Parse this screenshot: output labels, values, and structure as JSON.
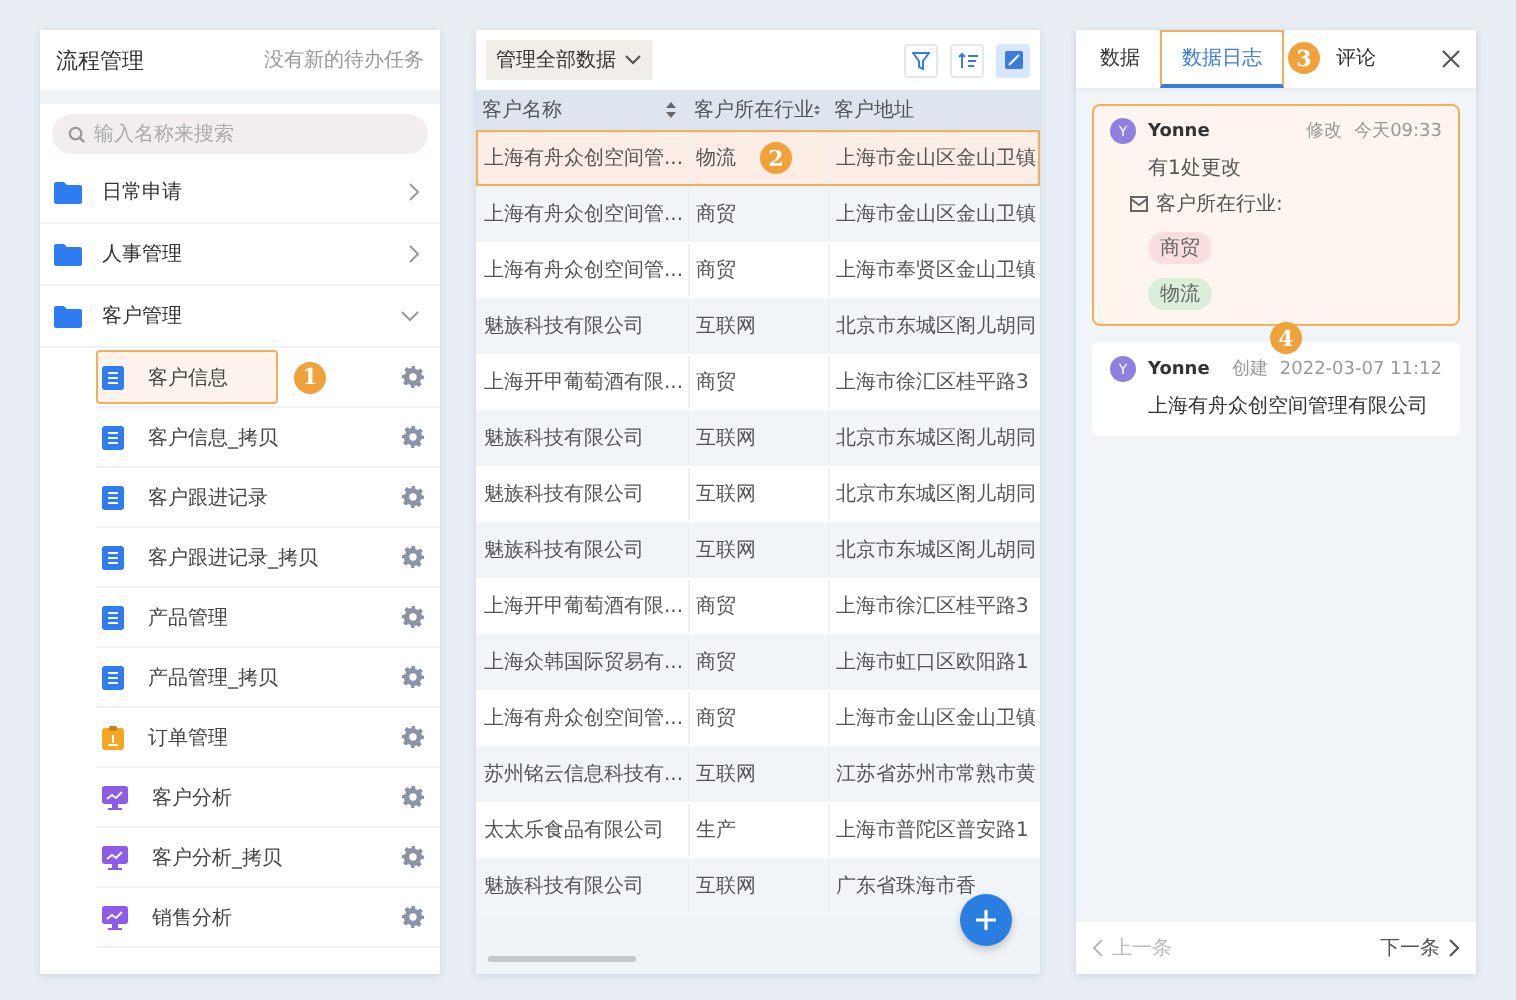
{
  "sidebar": {
    "title": "流程管理",
    "status": "没有新的待办任务",
    "search": {
      "placeholder": "输入名称来搜索"
    },
    "folders": [
      {
        "label": "日常申请",
        "expanded": false
      },
      {
        "label": "人事管理",
        "expanded": false
      },
      {
        "label": "客户管理",
        "expanded": true,
        "children": [
          {
            "label": "客户信息",
            "kind": "doc",
            "selected": true,
            "badge": "1"
          },
          {
            "label": "客户信息_拷贝",
            "kind": "doc",
            "selected": false
          },
          {
            "label": "客户跟进记录",
            "kind": "doc",
            "selected": false
          },
          {
            "label": "客户跟进记录_拷贝",
            "kind": "doc",
            "selected": false
          },
          {
            "label": "产品管理",
            "kind": "doc",
            "selected": false
          },
          {
            "label": "产品管理_拷贝",
            "kind": "doc",
            "selected": false
          },
          {
            "label": "订单管理",
            "kind": "order",
            "selected": false
          },
          {
            "label": "客户分析",
            "kind": "chart",
            "selected": false
          },
          {
            "label": "客户分析_拷贝",
            "kind": "chart",
            "selected": false
          },
          {
            "label": "销售分析",
            "kind": "chart",
            "selected": false
          }
        ]
      }
    ]
  },
  "table": {
    "scope": "管理全部数据",
    "tools": [
      {
        "kind": "filter",
        "selected": false
      },
      {
        "kind": "sort",
        "selected": false
      },
      {
        "kind": "view",
        "selected": true
      }
    ],
    "columns": [
      {
        "label": "客户名称",
        "sortable": true
      },
      {
        "label": "客户所在行业",
        "sortable": true
      },
      {
        "label": "客户地址",
        "sortable": false
      }
    ],
    "rows": [
      {
        "cells": [
          "上海有舟众创空间管...",
          "物流",
          "上海市金山区金山卫镇"
        ],
        "selected": true,
        "badge": "2"
      },
      {
        "cells": [
          "上海有舟众创空间管...",
          "商贸",
          "上海市金山区金山卫镇"
        ],
        "selected": false
      },
      {
        "cells": [
          "上海有舟众创空间管...",
          "商贸",
          "上海市奉贤区金山卫镇"
        ],
        "selected": false
      },
      {
        "cells": [
          "魅族科技有限公司",
          "互联网",
          "北京市东城区阁儿胡同"
        ],
        "selected": false
      },
      {
        "cells": [
          "上海开甲葡萄酒有限...",
          "商贸",
          "上海市徐汇区桂平路3"
        ],
        "selected": false
      },
      {
        "cells": [
          "魅族科技有限公司",
          "互联网",
          "北京市东城区阁儿胡同"
        ],
        "selected": false
      },
      {
        "cells": [
          "魅族科技有限公司",
          "互联网",
          "北京市东城区阁儿胡同"
        ],
        "selected": false
      },
      {
        "cells": [
          "魅族科技有限公司",
          "互联网",
          "北京市东城区阁儿胡同"
        ],
        "selected": false
      },
      {
        "cells": [
          "上海开甲葡萄酒有限...",
          "商贸",
          "上海市徐汇区桂平路3"
        ],
        "selected": false
      },
      {
        "cells": [
          "上海众韩国际贸易有...",
          "商贸",
          "上海市虹口区欧阳路1"
        ],
        "selected": false
      },
      {
        "cells": [
          "上海有舟众创空间管...",
          "商贸",
          "上海市金山区金山卫镇"
        ],
        "selected": false
      },
      {
        "cells": [
          "苏州铭云信息科技有...",
          "互联网",
          "江苏省苏州市常熟市黄"
        ],
        "selected": false
      },
      {
        "cells": [
          "太太乐食品有限公司",
          "生产",
          "上海市普陀区普安路1"
        ],
        "selected": false
      },
      {
        "cells": [
          "魅族科技有限公司",
          "互联网",
          "广东省珠海市香"
        ],
        "selected": false
      }
    ]
  },
  "detail": {
    "tabs": [
      {
        "label": "数据",
        "selected": false
      },
      {
        "label": "数据日志",
        "selected": true,
        "badge": "3"
      },
      {
        "label": "评论",
        "selected": false
      }
    ],
    "log": [
      {
        "kind": "update",
        "avatar": "Y",
        "user": "Yonne",
        "action": "修改",
        "time": "今天09:33",
        "highlighted": true,
        "summary": "有1处更改",
        "field": "客户所在行业:",
        "tags": [
          {
            "label": "商贸",
            "color": "#f8dede"
          },
          {
            "label": "物流",
            "color": "#daeeda"
          }
        ]
      },
      {
        "kind": "create",
        "avatar": "Y",
        "user": "Yonne",
        "action": "创建",
        "time": "2022-03-07 11:12",
        "highlighted": false,
        "badge": "4",
        "content": "上海有舟众创空间管理有限公司"
      }
    ],
    "prev": {
      "label": "上一条",
      "disabled": true
    },
    "next": {
      "label": "下一条",
      "disabled": false
    }
  }
}
